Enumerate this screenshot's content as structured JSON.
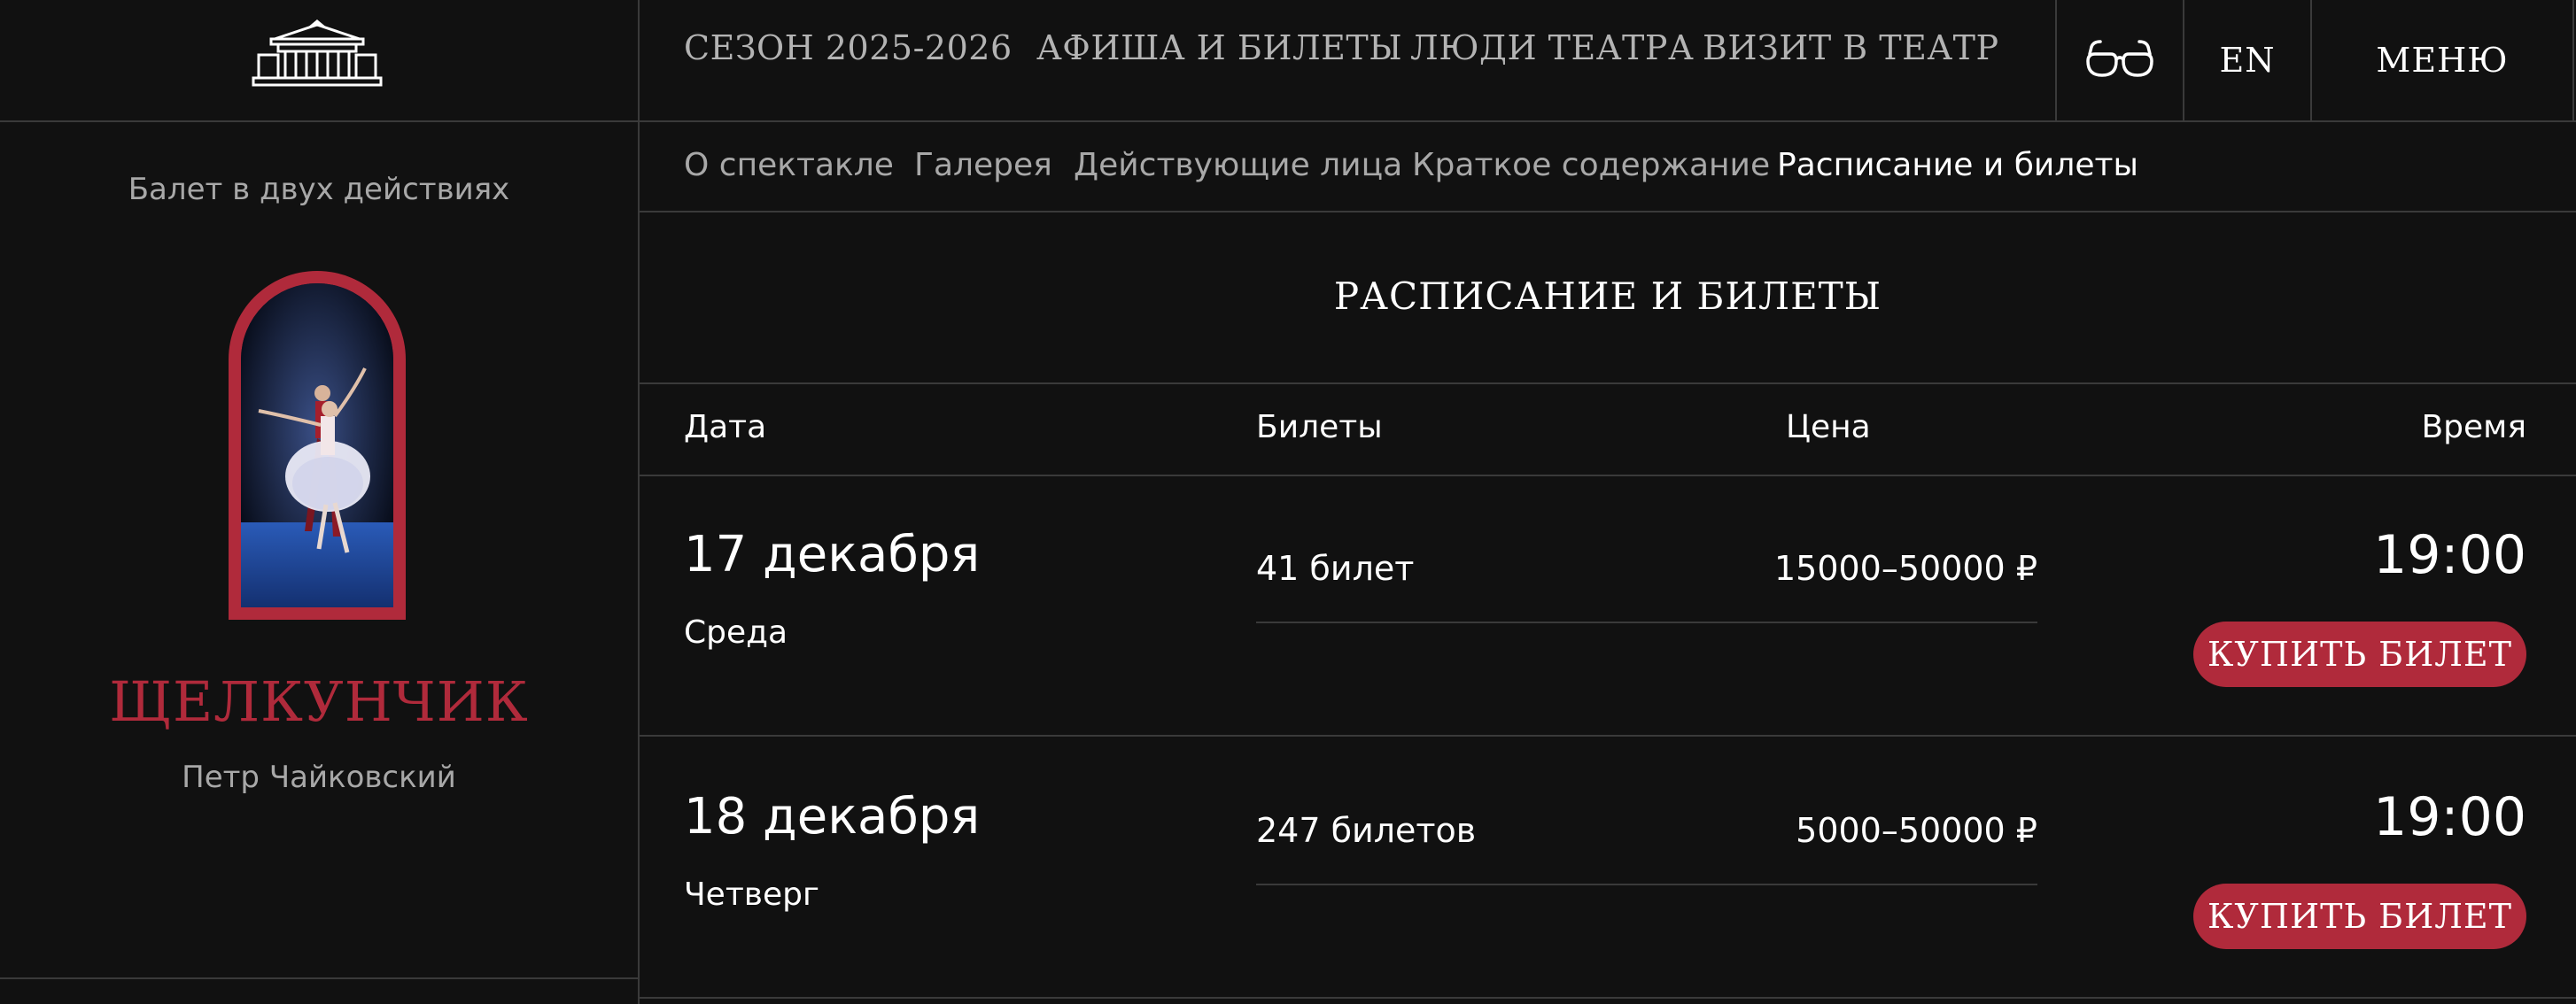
{
  "header": {
    "nav": [
      "СЕЗОН 2025-2026",
      "АФИША И БИЛЕТЫ",
      "ЛЮДИ ТЕАТРА",
      "ВИЗИТ В ТЕАТР"
    ],
    "accessibility_icon": "glasses-icon",
    "lang": "EN",
    "menu": "МЕНЮ"
  },
  "sidebar": {
    "subtitle": "Балет в двух действиях",
    "title": "ЩЕЛКУНЧИК",
    "composer": "Петр Чайковский"
  },
  "tabs": [
    "О спектакле",
    "Галерея",
    "Действующие лица",
    "Краткое содержание",
    "Расписание и билеты"
  ],
  "active_tab": "Расписание и билеты",
  "schedule": {
    "title": "РАСПИСАНИЕ И БИЛЕТЫ",
    "columns": {
      "date": "Дата",
      "tickets": "Билеты",
      "price": "Цена",
      "time": "Время"
    },
    "rows": [
      {
        "date": "17 декабря",
        "day": "Среда",
        "tickets": "41 билет",
        "price": "15000–50000 ₽",
        "time": "19:00",
        "buy": "КУПИТЬ БИЛЕТ"
      },
      {
        "date": "18 декабря",
        "day": "Четверг",
        "tickets": "247 билетов",
        "price": "5000–50000 ₽",
        "time": "19:00",
        "buy": "КУПИТЬ БИЛЕТ"
      }
    ]
  },
  "colors": {
    "background": "#111111",
    "accent": "#b02a3b",
    "muted_text": "#a8a8a8",
    "divider": "#3a3a3a"
  }
}
